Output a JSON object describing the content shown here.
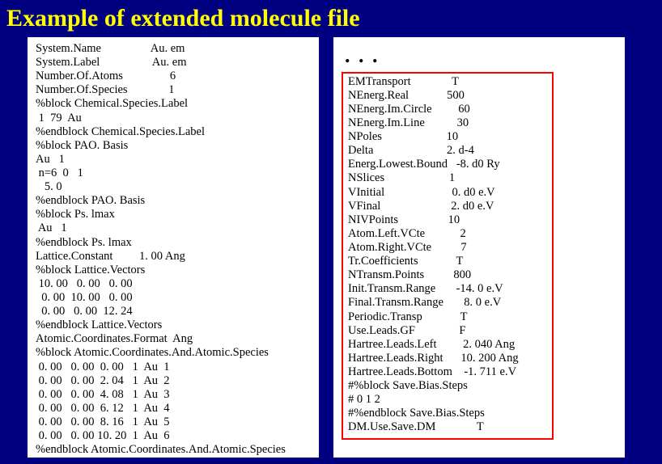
{
  "title": "Example of extended molecule file",
  "left_lines": [
    "System.Name                 Au. em",
    "System.Label                  Au. em",
    "Number.Of.Atoms                6",
    "Number.Of.Species              1",
    "%block Chemical.Species.Label",
    " 1  79  Au",
    "%endblock Chemical.Species.Label",
    "%block PAO. Basis",
    "Au   1",
    " n=6  0   1",
    "   5. 0",
    "%endblock PAO. Basis",
    "%block Ps. lmax",
    " Au   1",
    "%endblock Ps. lmax",
    "Lattice.Constant         1. 00 Ang",
    "%block Lattice.Vectors",
    " 10. 00   0. 00   0. 00",
    "  0. 00  10. 00   0. 00",
    "  0. 00   0. 00  12. 24",
    "%endblock Lattice.Vectors",
    "Atomic.Coordinates.Format  Ang",
    "%block Atomic.Coordinates.And.Atomic.Species",
    " 0. 00   0. 00  0. 00   1  Au  1",
    " 0. 00   0. 00  2. 04   1  Au  2",
    " 0. 00   0. 00  4. 08   1  Au  3",
    " 0. 00   0. 00  6. 12   1  Au  4",
    " 0. 00   0. 00  8. 16   1  Au  5",
    " 0. 00   0. 00 10. 20  1  Au  6",
    "%endblock Atomic.Coordinates.And.Atomic.Species"
  ],
  "ellipsis": ". . .",
  "right_lines": [
    "EMTransport              T",
    "NEnerg.Real             500",
    "NEnerg.Im.Circle         60",
    "NEnerg.Im.Line           30",
    "NPoles                      10",
    "Delta                         2. d-4",
    "Energ.Lowest.Bound   -8. d0 Ry",
    "NSlices                      1",
    "VInitial                       0. d0 e.V",
    "VFinal                        2. d0 e.V",
    "NIVPoints                 10",
    "Atom.Left.VCte            2",
    "Atom.Right.VCte          7",
    "Tr.Coefficients             T",
    "NTransm.Points          800",
    "Init.Transm.Range       -14. 0 e.V",
    "Final.Transm.Range       8. 0 e.V",
    "Periodic.Transp             T",
    "Use.Leads.GF               F",
    "Hartree.Leads.Left         2. 040 Ang",
    "Hartree.Leads.Right      10. 200 Ang",
    "Hartree.Leads.Bottom    -1. 711 e.V",
    "#%block Save.Bias.Steps",
    "# 0 1 2",
    "#%endblock Save.Bias.Steps",
    "DM.Use.Save.DM              T"
  ]
}
